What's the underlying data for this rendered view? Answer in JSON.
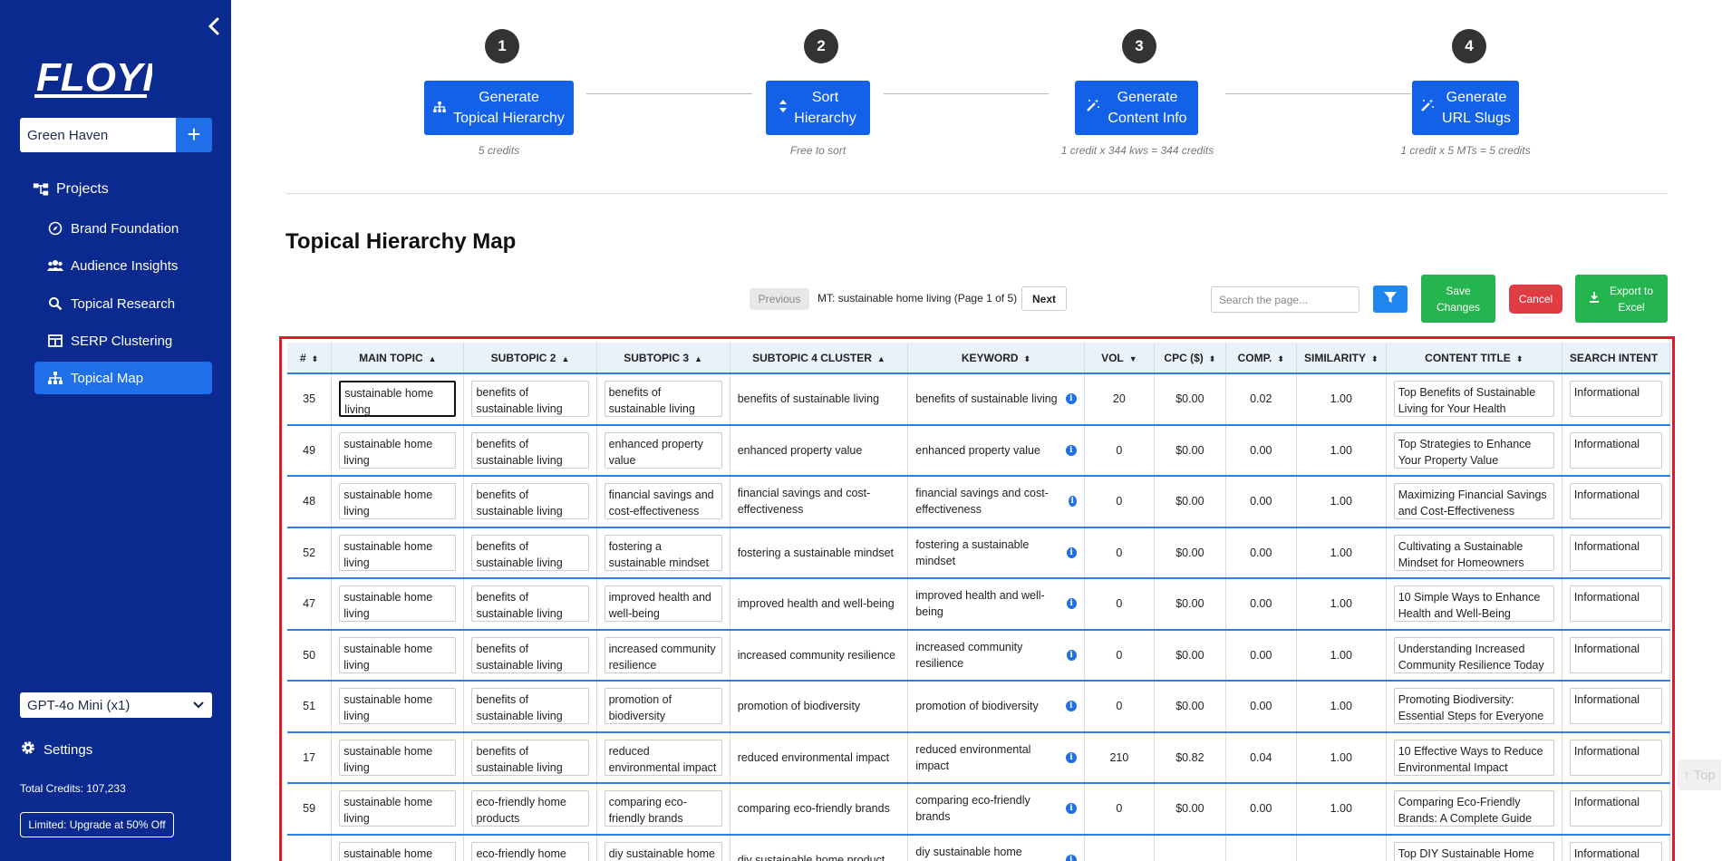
{
  "sidebar": {
    "logo_text": "FLOYI",
    "project_name": "Green Haven",
    "add_label": "+",
    "nav": [
      {
        "label": "Projects"
      },
      {
        "label": "Brand Foundation"
      },
      {
        "label": "Audience Insights"
      },
      {
        "label": "Topical Research"
      },
      {
        "label": "SERP Clustering"
      },
      {
        "label": "Topical Map"
      }
    ],
    "model": "GPT-4o Mini (x1)",
    "settings_label": "Settings",
    "credits": "Total Credits: 107,233",
    "upgrade": "Limited: Upgrade at 50% Off"
  },
  "steps": [
    {
      "num": "1",
      "line1": "Generate",
      "line2": "Topical Hierarchy",
      "note": "5 credits",
      "icon": "hierarchy-icon"
    },
    {
      "num": "2",
      "line1": "Sort",
      "line2": "Hierarchy",
      "note": "Free to sort",
      "icon": "sort-icon"
    },
    {
      "num": "3",
      "line1": "Generate",
      "line2": "Content Info",
      "note": "1 credit x 344 kws = 344 credits",
      "icon": "magic-wand-icon"
    },
    {
      "num": "4",
      "line1": "Generate",
      "line2": "URL Slugs",
      "note": "1 credit x 5 MTs = 5 credits",
      "icon": "magic-wand-icon"
    }
  ],
  "main": {
    "title": "Topical Hierarchy Map",
    "pager": {
      "previous": "Previous",
      "info": "MT: sustainable home living (Page 1 of 5)",
      "next": "Next"
    },
    "search_placeholder": "Search the page...",
    "save_line1": "Save",
    "save_line2": "Changes",
    "cancel": "Cancel",
    "export_line1": "Export to",
    "export_line2": "Excel",
    "top_button": "↑ Top"
  },
  "table": {
    "columns": [
      "#",
      "MAIN TOPIC",
      "SUBTOPIC 2",
      "SUBTOPIC 3",
      "SUBTOPIC 4 CLUSTER",
      "KEYWORD",
      "VOL",
      "CPC ($)",
      "COMP.",
      "SIMILARITY",
      "CONTENT TITLE",
      "SEARCH INTENT"
    ],
    "sort_marks": [
      "⬍",
      "▲",
      "▲",
      "▲",
      "▲",
      "⬍",
      "▼",
      "⬍",
      "⬍",
      "⬍",
      "⬍",
      ""
    ],
    "rows": [
      {
        "id": "35",
        "main": "sustainable home living",
        "sub2": "benefits of sustainable living",
        "sub3": "benefits of sustainable living",
        "sub4": "benefits of sustainable living",
        "kw": "benefits of sustainable living",
        "vol": "20",
        "cpc": "$0.00",
        "comp": "0.02",
        "sim": "1.00",
        "title": "Top Benefits of Sustainable Living for Your Health",
        "intent": "Informational"
      },
      {
        "id": "49",
        "main": "sustainable home living",
        "sub2": "benefits of sustainable living",
        "sub3": "enhanced property value",
        "sub4": "enhanced property value",
        "kw": "enhanced property value",
        "vol": "0",
        "cpc": "$0.00",
        "comp": "0.00",
        "sim": "1.00",
        "title": "Top Strategies to Enhance Your Property Value",
        "intent": "Informational"
      },
      {
        "id": "48",
        "main": "sustainable home living",
        "sub2": "benefits of sustainable living",
        "sub3": "financial savings and cost-effectiveness",
        "sub4": "financial savings and cost-effectiveness",
        "kw": "financial savings and cost-effectiveness",
        "vol": "0",
        "cpc": "$0.00",
        "comp": "0.00",
        "sim": "1.00",
        "title": "Maximizing Financial Savings and Cost-Effectiveness",
        "intent": "Informational"
      },
      {
        "id": "52",
        "main": "sustainable home living",
        "sub2": "benefits of sustainable living",
        "sub3": "fostering a sustainable mindset",
        "sub4": "fostering a sustainable mindset",
        "kw": "fostering a sustainable mindset",
        "vol": "0",
        "cpc": "$0.00",
        "comp": "0.00",
        "sim": "1.00",
        "title": "Cultivating a Sustainable Mindset for Homeowners",
        "intent": "Informational"
      },
      {
        "id": "47",
        "main": "sustainable home living",
        "sub2": "benefits of sustainable living",
        "sub3": "improved health and well-being",
        "sub4": "improved health and well-being",
        "kw": "improved health and well-being",
        "vol": "0",
        "cpc": "$0.00",
        "comp": "0.00",
        "sim": "1.00",
        "title": "10 Simple Ways to Enhance Health and Well-Being",
        "intent": "Informational"
      },
      {
        "id": "50",
        "main": "sustainable home living",
        "sub2": "benefits of sustainable living",
        "sub3": "increased community resilience",
        "sub4": "increased community resilience",
        "kw": "increased community resilience",
        "vol": "0",
        "cpc": "$0.00",
        "comp": "0.00",
        "sim": "1.00",
        "title": "Understanding Increased Community Resilience Today",
        "intent": "Informational"
      },
      {
        "id": "51",
        "main": "sustainable home living",
        "sub2": "benefits of sustainable living",
        "sub3": "promotion of biodiversity",
        "sub4": "promotion of biodiversity",
        "kw": "promotion of biodiversity",
        "vol": "0",
        "cpc": "$0.00",
        "comp": "0.00",
        "sim": "1.00",
        "title": "Promoting Biodiversity: Essential Steps for Everyone",
        "intent": "Informational"
      },
      {
        "id": "17",
        "main": "sustainable home living",
        "sub2": "benefits of sustainable living",
        "sub3": "reduced environmental impact",
        "sub4": "reduced environmental impact",
        "kw": "reduced environmental impact",
        "vol": "210",
        "cpc": "$0.82",
        "comp": "0.04",
        "sim": "1.00",
        "title": "10 Effective Ways to Reduce Environmental Impact",
        "intent": "Informational"
      },
      {
        "id": "59",
        "main": "sustainable home living",
        "sub2": "eco-friendly home products",
        "sub3": "comparing eco-friendly brands",
        "sub4": "comparing eco-friendly brands",
        "kw": "comparing eco-friendly brands",
        "vol": "0",
        "cpc": "$0.00",
        "comp": "0.00",
        "sim": "1.00",
        "title": "Comparing Eco-Friendly Brands: A Complete Guide",
        "intent": "Informational"
      },
      {
        "id": "",
        "main": "sustainable home living",
        "sub2": "eco-friendly home products",
        "sub3": "diy sustainable home products",
        "sub4": "diy sustainable home product",
        "kw": "diy sustainable home product",
        "vol": "",
        "cpc": "",
        "comp": "",
        "sim": "",
        "title": "Top DIY Sustainable Home Products",
        "intent": "Informational"
      }
    ]
  }
}
